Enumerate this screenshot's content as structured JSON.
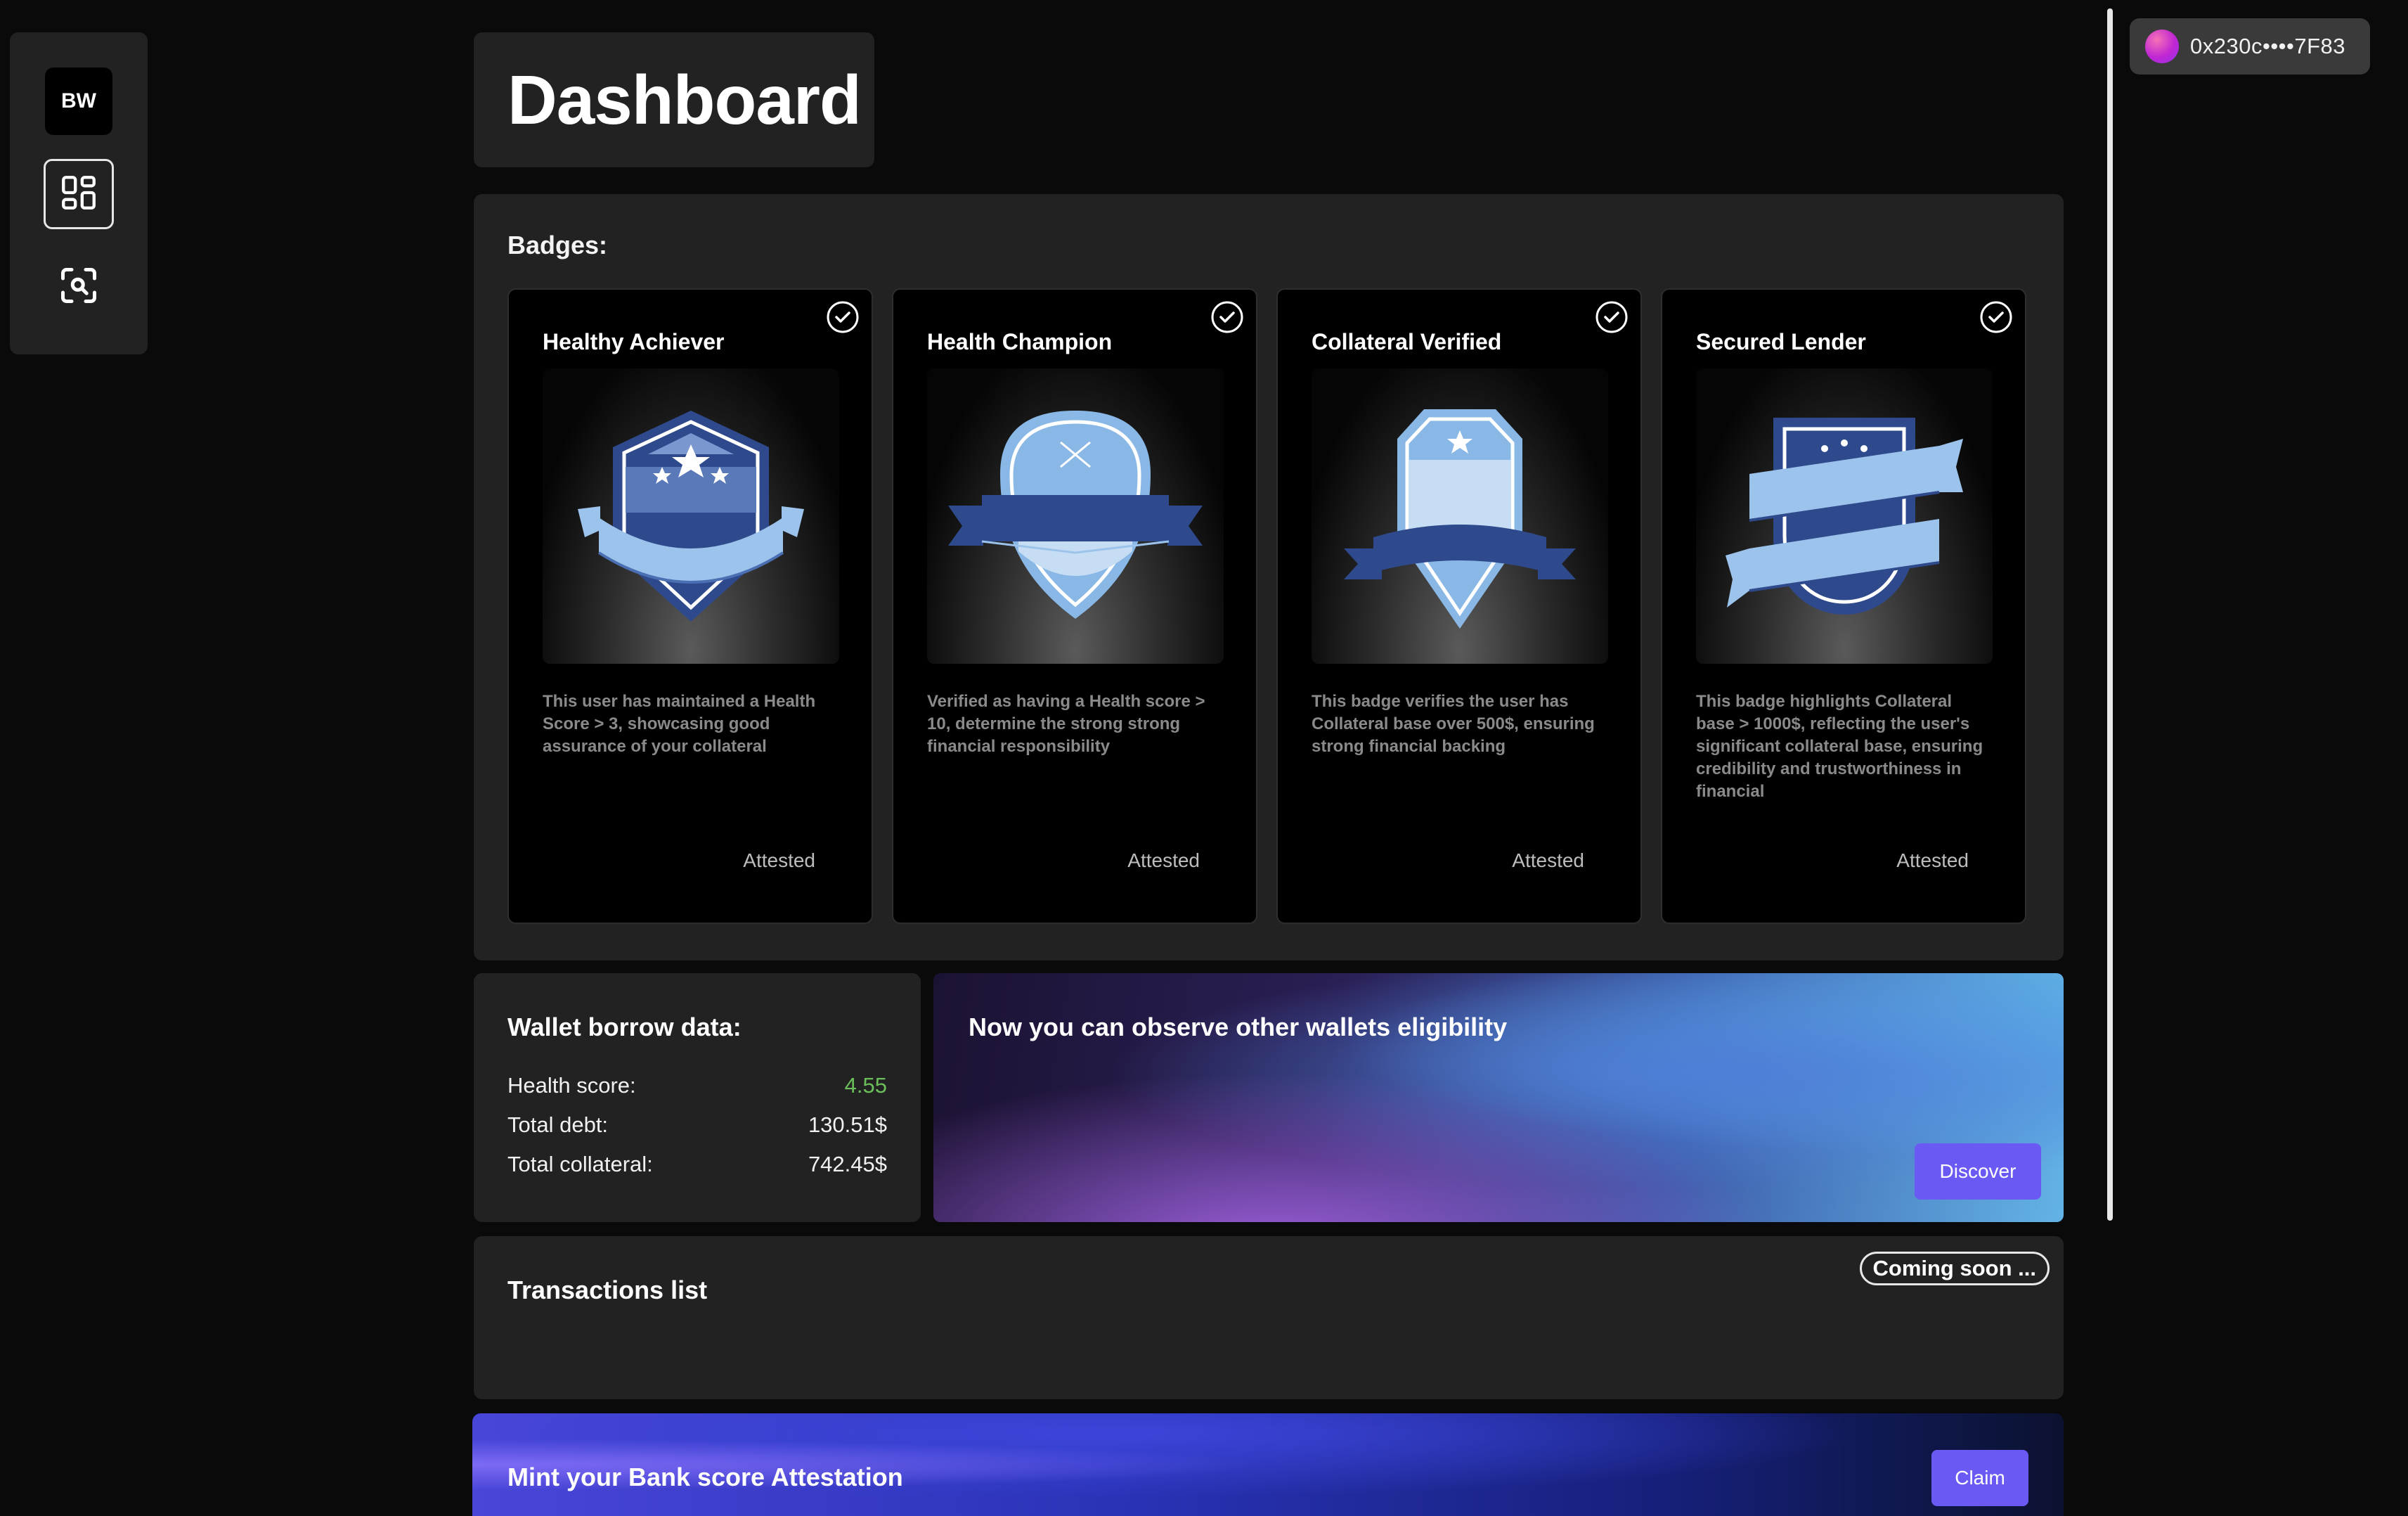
{
  "sidebar": {
    "logo_text": "BW",
    "items": [
      {
        "icon": "dashboard-grid-icon",
        "active": true
      },
      {
        "icon": "scan-search-icon",
        "active": false
      }
    ]
  },
  "header": {
    "title": "Dashboard"
  },
  "wallet": {
    "address": "0x230c••••7F83"
  },
  "badges": {
    "title": "Badges:",
    "items": [
      {
        "name": "Healthy Achiever",
        "description": "This user has maintained a Health Score > 3, showcasing good assurance of your collateral",
        "status": "Attested",
        "icon": "shield-stars-badge-icon"
      },
      {
        "name": "Health Champion",
        "description": "Verified as having a Health score > 10, determine the strong strong financial responsibility",
        "status": "Attested",
        "icon": "round-shield-banner-badge-icon"
      },
      {
        "name": "Collateral Verified",
        "description": "This badge verifies the user has Collateral base over 500$, ensuring strong financial backing",
        "status": "Attested",
        "icon": "crest-star-badge-icon"
      },
      {
        "name": "Secured Lender",
        "description": "This badge highlights Collateral base > 1000$, reflecting the user's significant collateral base, ensuring credibility and trustworthiness in financial",
        "status": "Attested",
        "icon": "shield-ribbons-badge-icon"
      }
    ]
  },
  "borrow": {
    "title": "Wallet borrow data:",
    "rows": [
      {
        "label": "Health score:",
        "value": "4.55"
      },
      {
        "label": "Total debt:",
        "value": "130.51$"
      },
      {
        "label": "Total collateral:",
        "value": "742.45$"
      }
    ],
    "colors": {
      "good": "#6bbf5a"
    }
  },
  "promo": {
    "title": "Now you can observe other wallets eligibility",
    "button": "Discover"
  },
  "transactions": {
    "title": "Transactions list",
    "badge": "Coming soon ..."
  },
  "mint": {
    "title": "Mint your Bank score Attestation",
    "button": "Claim"
  },
  "colors": {
    "accent": "#6a5af3",
    "panel": "#222222",
    "background": "#0a0a0a"
  }
}
